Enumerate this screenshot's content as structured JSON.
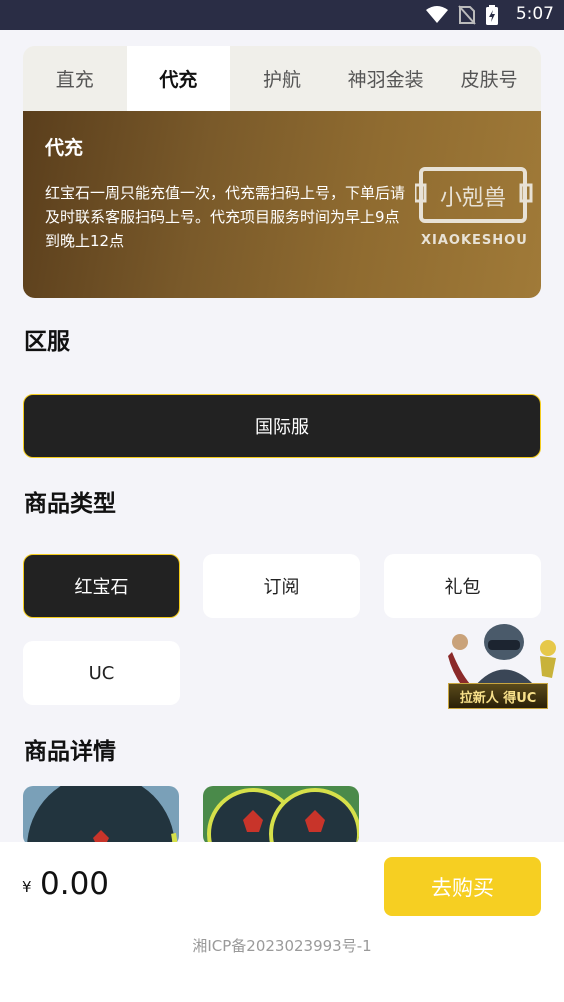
{
  "status_bar": {
    "time": "5:07",
    "icons": [
      "wifi-icon",
      "no-sim-icon",
      "battery-charging-icon"
    ]
  },
  "tabs": [
    {
      "label": "直充",
      "active": false
    },
    {
      "label": "代充",
      "active": true
    },
    {
      "label": "护航",
      "active": false
    },
    {
      "label": "神羽金装",
      "active": false
    },
    {
      "label": "皮肤号",
      "active": false
    }
  ],
  "banner": {
    "title": "代充",
    "description": "红宝石一周只能充值一次，代充需扫码上号，下单后请及时联系客服扫码上号。代充项目服务时间为早上9点到晚上12点",
    "logo_text": "XIAOKESHOU",
    "logo_mark": "小剋兽"
  },
  "server_section": {
    "title": "区服",
    "selected": "国际服"
  },
  "product_type_section": {
    "title": "商品类型",
    "options": [
      {
        "label": "红宝石",
        "selected": true
      },
      {
        "label": "订阅",
        "selected": false
      },
      {
        "label": "礼包",
        "selected": false
      },
      {
        "label": "UC",
        "selected": false
      }
    ]
  },
  "promo": {
    "label": "拉新人 得UC"
  },
  "details_section": {
    "title": "商品详情"
  },
  "bottom": {
    "currency": "¥",
    "price": "0.00",
    "buy_label": "去购买",
    "icp": "湘ICP备2023023993号-1"
  },
  "colors": {
    "accent": "#f6cf22",
    "dark": "#222222",
    "status_bar": "#2a2d45",
    "banner": "#8f6b30"
  }
}
